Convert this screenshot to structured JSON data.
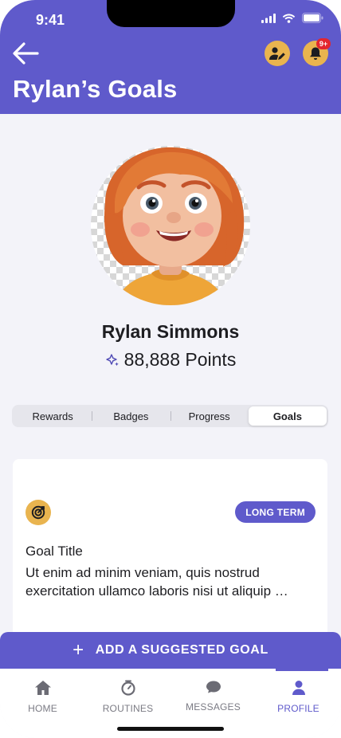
{
  "status": {
    "time": "9:41"
  },
  "header": {
    "title": "Rylan’s Goals",
    "notification_count": "9+"
  },
  "profile": {
    "name": "Rylan Simmons",
    "points": "88,888 Points"
  },
  "tabs": [
    {
      "label": "Rewards",
      "active": false
    },
    {
      "label": "Badges",
      "active": false
    },
    {
      "label": "Progress",
      "active": false
    },
    {
      "label": "Goals",
      "active": true
    }
  ],
  "goal_card": {
    "tag": "LONG TERM",
    "title": "Goal Title",
    "description": "Ut enim ad minim veniam, quis nostrud exercitation ullamco laboris nisi ut aliquip …"
  },
  "add_goal": {
    "label": "ADD A SUGGESTED GOAL"
  },
  "bottom_nav": [
    {
      "label": "HOME",
      "icon": "home-icon"
    },
    {
      "label": "ROUTINES",
      "icon": "timer-icon"
    },
    {
      "label": "MESSAGES",
      "icon": "chat-bubble-icon"
    },
    {
      "label": "PROFILE",
      "icon": "person-icon",
      "active": true
    }
  ],
  "colors": {
    "brand_purple": "#5f5acb",
    "accent_gold": "#e9b44f",
    "badge_red": "#e3262e",
    "background": "#f3f3f9"
  }
}
